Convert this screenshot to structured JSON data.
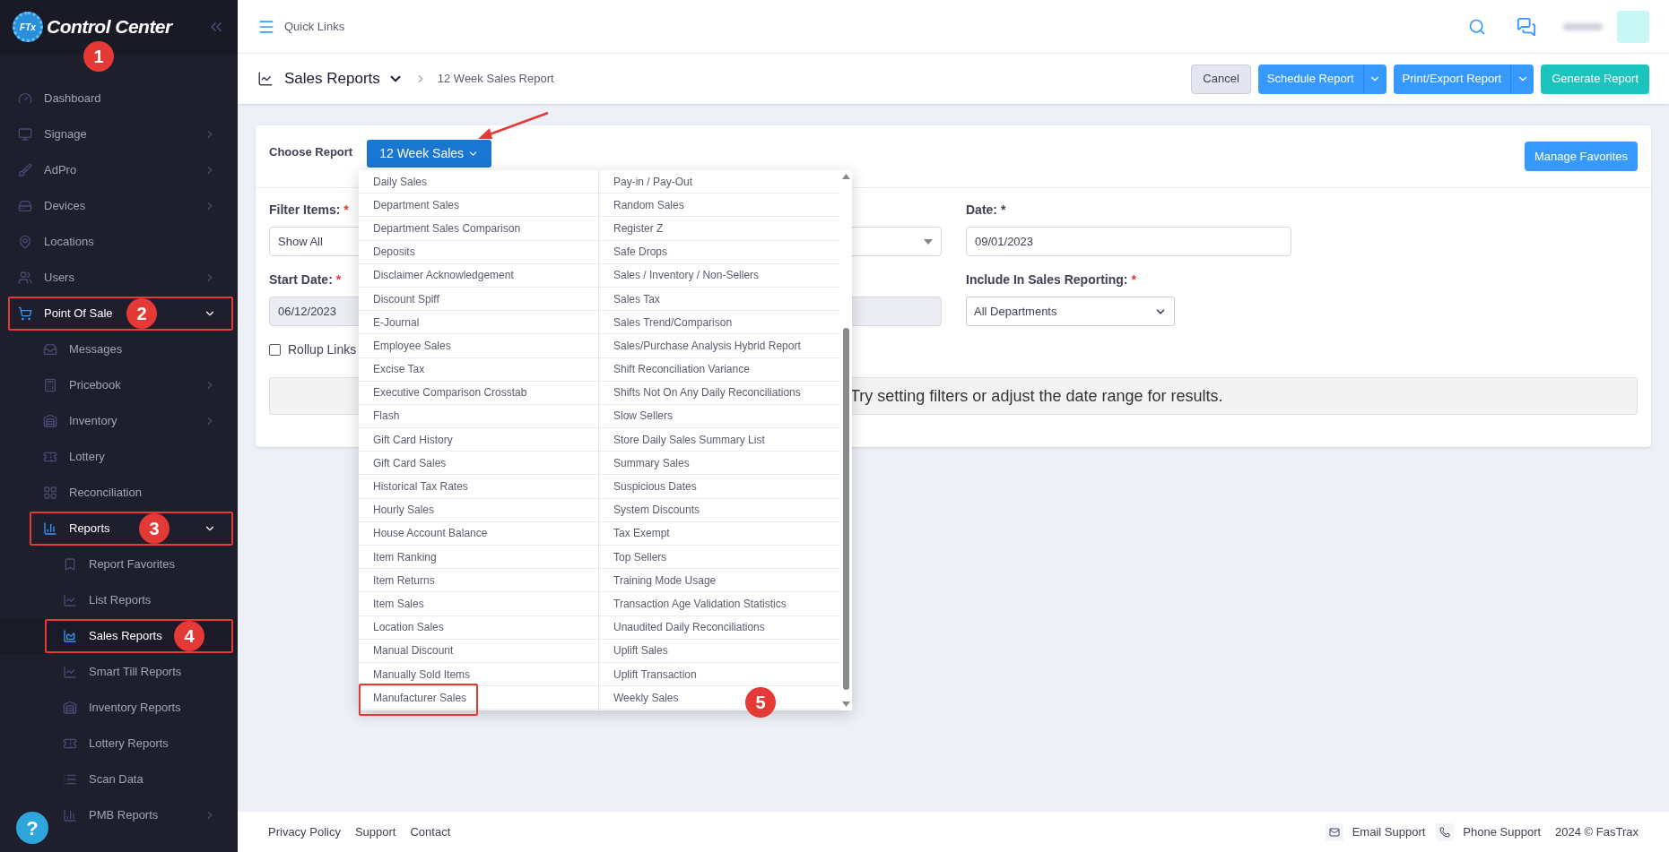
{
  "sidebar": {
    "logo": {
      "mark": "FTx",
      "title": "Control Center",
      "callout": "1"
    },
    "items": [
      {
        "label": "Dashboard"
      },
      {
        "label": "Signage",
        "expanded": false
      },
      {
        "label": "AdPro",
        "expanded": false
      },
      {
        "label": "Devices",
        "expanded": false
      },
      {
        "label": "Locations"
      },
      {
        "label": "Users",
        "expanded": false
      },
      {
        "label": "Point Of Sale",
        "expanded": true,
        "callout": "2",
        "children": [
          {
            "label": "Messages"
          },
          {
            "label": "Pricebook",
            "expanded": false
          },
          {
            "label": "Inventory",
            "expanded": false
          },
          {
            "label": "Lottery"
          },
          {
            "label": "Reconciliation"
          },
          {
            "label": "Reports",
            "expanded": true,
            "callout": "3",
            "children": [
              {
                "label": "Report Favorites",
                "selected": false
              },
              {
                "label": "List Reports",
                "selected": false
              },
              {
                "label": "Sales Reports",
                "selected": true,
                "callout": "4"
              },
              {
                "label": "Smart Till Reports",
                "selected": false
              },
              {
                "label": "Inventory Reports",
                "selected": false
              },
              {
                "label": "Lottery Reports",
                "selected": false
              },
              {
                "label": "Scan Data",
                "selected": false
              },
              {
                "label": "PMB Reports",
                "selected": false,
                "expanded": false
              }
            ]
          }
        ]
      }
    ],
    "help": "?"
  },
  "top_bar": {
    "title": "Quick Links"
  },
  "page_header": {
    "title": "Sales Reports",
    "breadcrumb": "12 Week Sales Report",
    "buttons": [
      {
        "label": "Cancel",
        "kind": "plain"
      },
      {
        "label": "Schedule Report",
        "kind": "split"
      },
      {
        "label": "Print/Export Report",
        "kind": "split"
      },
      {
        "label": "Generate Report",
        "kind": "success"
      }
    ]
  },
  "report_card": {
    "choose_label": "Choose Report",
    "report_button": {
      "label": "12 Week Sales",
      "pointed": true
    },
    "manage_button": "Manage Favorites",
    "fields": [
      {
        "label": "Filter Items:",
        "required_mark": "*",
        "kind": "select",
        "value": "Show All"
      },
      {
        "label": "Date: *",
        "kind": "text",
        "value": "09/01/2023"
      },
      {
        "label": "Start Date:",
        "required_mark": "*",
        "kind": "date",
        "value": "06/12/2023",
        "disabled": true
      },
      {
        "label": "Include In Sales Reporting:",
        "required_mark": "*",
        "kind": "native-select",
        "value": "All Departments"
      }
    ],
    "rollup": {
      "label": "Rollup Links",
      "checked": false
    },
    "message": "Try setting filters or adjust the date range for results.",
    "menu": {
      "columns": [
        {
          "items": [
            {
              "label": "Daily Sales"
            },
            {
              "label": "Department Sales"
            },
            {
              "label": "Department Sales Comparison"
            },
            {
              "label": "Deposits"
            },
            {
              "label": "Disclaimer Acknowledgement"
            },
            {
              "label": "Discount Spiff"
            },
            {
              "label": "E-Journal"
            },
            {
              "label": "Employee Sales"
            },
            {
              "label": "Excise Tax"
            },
            {
              "label": "Executive Comparison Crosstab"
            },
            {
              "label": "Flash"
            },
            {
              "label": "Gift Card History"
            },
            {
              "label": "Gift Card Sales"
            },
            {
              "label": "Historical Tax Rates"
            },
            {
              "label": "Hourly Sales"
            },
            {
              "label": "House Account Balance"
            },
            {
              "label": "Item Ranking"
            },
            {
              "label": "Item Returns"
            },
            {
              "label": "Item Sales"
            },
            {
              "label": "Location Sales"
            },
            {
              "label": "Manual Discount"
            },
            {
              "label": "Manually Sold Items"
            },
            {
              "label": "Manufacturer Sales",
              "callout": "5"
            }
          ]
        },
        {
          "items": [
            {
              "label": "Pay-in / Pay-Out"
            },
            {
              "label": "Random Sales"
            },
            {
              "label": "Register Z"
            },
            {
              "label": "Safe Drops"
            },
            {
              "label": "Sales / Inventory / Non-Sellers"
            },
            {
              "label": "Sales Tax"
            },
            {
              "label": "Sales Trend/Comparison"
            },
            {
              "label": "Sales/Purchase Analysis Hybrid Report"
            },
            {
              "label": "Shift Reconciliation Variance"
            },
            {
              "label": "Shifts Not On Any Daily Reconciliations"
            },
            {
              "label": "Slow Sellers"
            },
            {
              "label": "Store Daily Sales Summary List"
            },
            {
              "label": "Summary Sales"
            },
            {
              "label": "Suspicious Dates"
            },
            {
              "label": "System Discounts"
            },
            {
              "label": "Tax Exempt"
            },
            {
              "label": "Top Sellers"
            },
            {
              "label": "Training Mode Usage"
            },
            {
              "label": "Transaction Age Validation Statistics"
            },
            {
              "label": "Unaudited Daily Reconciliations"
            },
            {
              "label": "Uplift Sales"
            },
            {
              "label": "Uplift Transaction"
            },
            {
              "label": "Weekly Sales"
            }
          ]
        }
      ]
    }
  },
  "footer": {
    "links": [
      "Privacy Policy",
      "Support",
      "Contact"
    ],
    "support": [
      {
        "label": "Email Support",
        "kind": "email"
      },
      {
        "label": "Phone Support",
        "kind": "phone"
      }
    ],
    "copyright": "2024 © FasTrax"
  }
}
